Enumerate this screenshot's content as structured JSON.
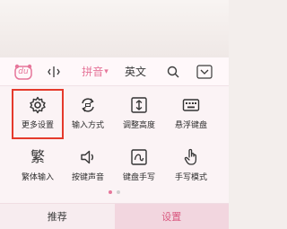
{
  "toolbar": {
    "logo_text": "du",
    "cursor_icon": "text-cursor-icon",
    "pinyin_label": "拼音",
    "caret": "▾",
    "english_label": "英文",
    "search_icon": "search-icon",
    "collapse_icon": "chevron-down-icon"
  },
  "grid": {
    "items": [
      {
        "label": "更多设置",
        "icon": "gear-icon"
      },
      {
        "label": "输入方式",
        "icon": "input-mode-icon"
      },
      {
        "label": "调整高度",
        "icon": "adjust-height-icon"
      },
      {
        "label": "悬浮键盘",
        "icon": "floating-keyboard-icon"
      },
      {
        "label": "繁体输入",
        "icon": "traditional-chinese-icon",
        "glyph": "繁"
      },
      {
        "label": "按键声音",
        "icon": "speaker-icon"
      },
      {
        "label": "键盘手写",
        "icon": "handwrite-keyboard-icon"
      },
      {
        "label": "手写模式",
        "icon": "hand-icon"
      }
    ]
  },
  "pager": {
    "pages": 2,
    "current": 1
  },
  "bottom_tabs": {
    "recommend": "推荐",
    "settings": "设置"
  },
  "colors": {
    "accent": "#e6769a",
    "highlight": "#e53a2c",
    "keyboard_bg": "#fbf3f5"
  }
}
